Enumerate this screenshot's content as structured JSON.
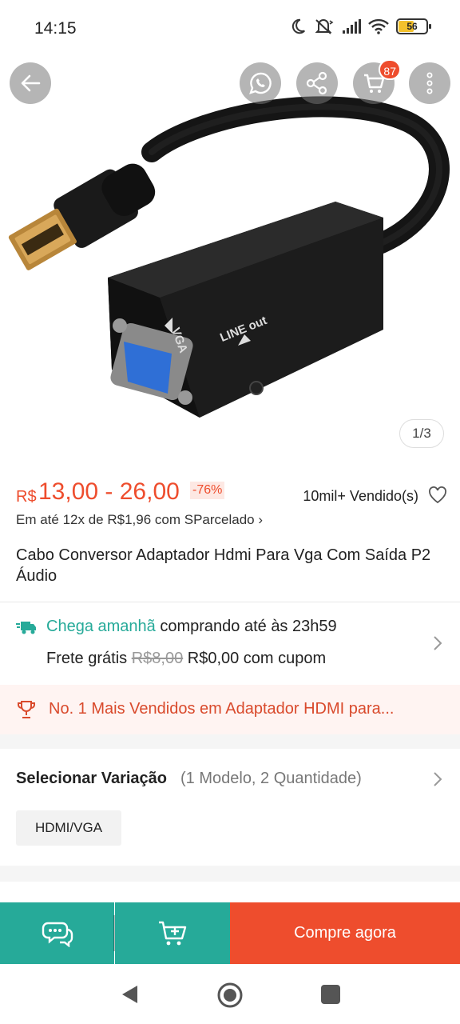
{
  "status_bar": {
    "time": "14:15",
    "battery": "56"
  },
  "hero": {
    "cart_count": "87",
    "page_indicator": "1/3",
    "label_vga": "VGA",
    "label_line_out": "LINE out",
    "icons": [
      "back-arrow-icon",
      "whatsapp-icon",
      "share-icon",
      "cart-icon",
      "more-icon"
    ]
  },
  "price": {
    "currency": "R$",
    "range": "13,00 - 26,00",
    "discount": "-76%",
    "sold": "10mil+ Vendido(s)",
    "installment": "Em até 12x de R$1,96 com SParcelado ›"
  },
  "product": {
    "title": "Cabo Conversor Adaptador Hdmi Para Vga Com Saída P2 Áudio"
  },
  "shipping": {
    "arrival_highlight": "Chega amanhã",
    "arrival_rest": " comprando até às 23h59",
    "free_label": "Frete grátis ",
    "old_price": "R$8,00",
    "new_price": " R$0,00 com cupom"
  },
  "bestseller": {
    "text": "No. 1 Mais Vendidos em Adaptador HDMI para..."
  },
  "variation": {
    "label": "Selecionar Variação",
    "sub": "(1 Modelo, 2 Quantidade)",
    "chip": "HDMI/VGA"
  },
  "actions": {
    "buy_label": "Compre agora"
  },
  "colors": {
    "accent": "#ee4d2d",
    "teal": "#26aa99"
  }
}
